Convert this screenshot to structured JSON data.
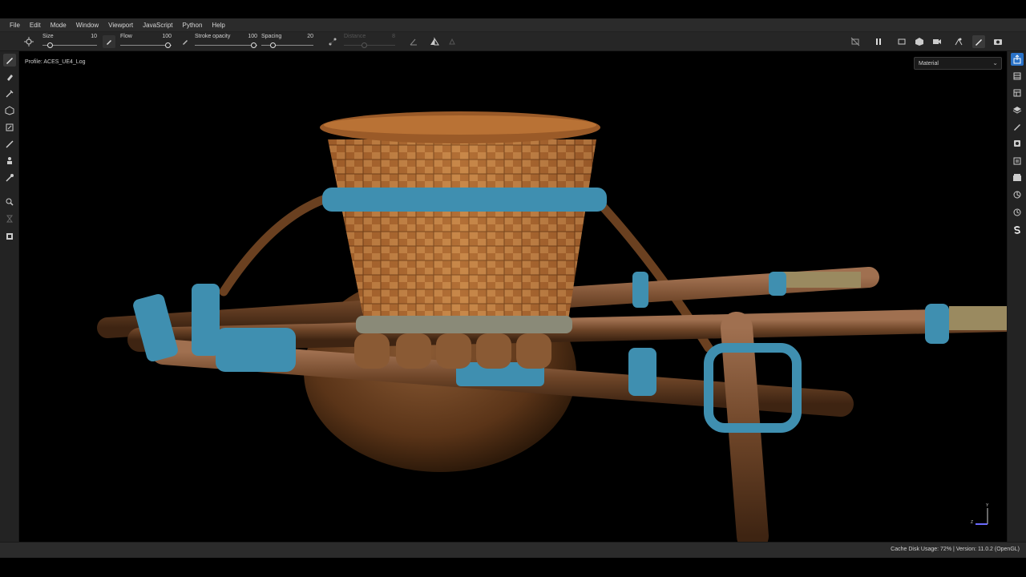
{
  "menubar": {
    "items": [
      "File",
      "Edit",
      "Mode",
      "Window",
      "Viewport",
      "JavaScript",
      "Python",
      "Help"
    ]
  },
  "toolbar": {
    "params": [
      {
        "label": "Size",
        "value": "10",
        "level": 0.1
      },
      {
        "label": "Flow",
        "value": "100",
        "level": 1.0
      },
      {
        "label": "Stroke opacity",
        "value": "100",
        "level": 1.0
      },
      {
        "label": "Spacing",
        "value": "20",
        "level": 0.2
      },
      {
        "label": "Distance",
        "value": "8",
        "level": 0.4,
        "disabled": true
      }
    ],
    "left_icons": [
      "brush-settings-icon",
      "paint-mode-icon",
      "flow-brush-icon"
    ],
    "right_icons": [
      "camera-off-icon",
      "pause-icon",
      "2d-view-icon",
      "3d-view-icon",
      "camera-icon",
      "lighting-icon",
      "paint-brush-icon",
      "screenshot-icon"
    ]
  },
  "left_tools": [
    "paint-brush-icon",
    "eraser-icon",
    "projection-icon",
    "polygon-fill-icon",
    "smudge-icon",
    "clone-icon",
    "picker-icon",
    "geometry-mask-icon",
    "bake-icon",
    "timer-icon",
    "layer-stack-icon"
  ],
  "right_panels": [
    "export-icon",
    "layers-panel-icon",
    "texture-set-icon",
    "stack-icon",
    "properties-icon",
    "display-settings-icon",
    "shelf-icon",
    "library-icon",
    "history-icon",
    "viewport-settings-icon",
    "substance-icon"
  ],
  "viewport": {
    "profile": "Profile: ACES_UE4_Log",
    "channel": "Material",
    "gizmo_label_y": "Y",
    "gizmo_label_z": "Z"
  },
  "status": {
    "text": "Cache Disk Usage:    72% | Version: 11.0.2 (OpenGL)"
  },
  "colors": {
    "accent": "#2a72c7",
    "rope": "#3f8fb0",
    "wood": "#7a4a28",
    "basket": "#b06a32"
  }
}
